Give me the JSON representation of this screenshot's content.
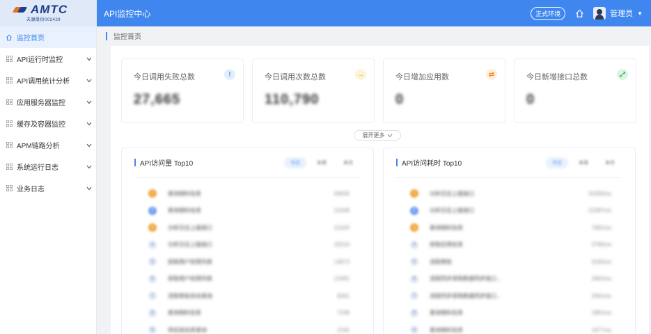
{
  "header": {
    "logo_text": "AMTC",
    "logo_subtitle": "天源股份002429",
    "app_title": "API监控中心",
    "env_badge": "正式环境",
    "user_name": "管理员",
    "colors": {
      "primary": "#3f86ef",
      "logo_bg": "#dfe9f8"
    }
  },
  "sidebar": {
    "items": [
      {
        "label": "监控首页",
        "icon": "home-icon",
        "active": true,
        "expandable": false
      },
      {
        "label": "API运行时监控",
        "icon": "grid-icon",
        "active": false,
        "expandable": true
      },
      {
        "label": "API调用统计分析",
        "icon": "grid-icon",
        "active": false,
        "expandable": true
      },
      {
        "label": "应用服务器监控",
        "icon": "grid-icon",
        "active": false,
        "expandable": true
      },
      {
        "label": "缓存及容器监控",
        "icon": "grid-icon",
        "active": false,
        "expandable": true
      },
      {
        "label": "APM链路分析",
        "icon": "grid-icon",
        "active": false,
        "expandable": true
      },
      {
        "label": "系统运行日志",
        "icon": "grid-icon",
        "active": false,
        "expandable": true
      },
      {
        "label": "业务日志",
        "icon": "grid-icon",
        "active": false,
        "expandable": true
      }
    ]
  },
  "breadcrumb": "监控首页",
  "stats": [
    {
      "title": "今日调用失败总数",
      "value": "27,665",
      "icon_glyph": "!",
      "icon_name": "alert-icon",
      "icon_color": "#3f86ef",
      "icon_bg": "#e3eefd"
    },
    {
      "title": "今日调用次数总数",
      "value": "110,790",
      "icon_glyph": "→",
      "icon_name": "arrow-right-icon",
      "icon_color": "#f2a60d",
      "icon_bg": "#fdf3dc"
    },
    {
      "title": "今日增加应用数",
      "value": "0",
      "icon_glyph": "⇄",
      "icon_name": "exchange-icon",
      "icon_color": "#f08a1c",
      "icon_bg": "#fdeedd"
    },
    {
      "title": "今日新增接口总数",
      "value": "0",
      "icon_glyph": "⤢",
      "icon_name": "link-icon",
      "icon_color": "#2bb04b",
      "icon_bg": "#def5e4"
    }
  ],
  "expand_label": "展开更多",
  "rank_panels": [
    {
      "title": "API访问量 Top10",
      "tabs": [
        "今日",
        "本周",
        "本月"
      ],
      "rows": [
        {
          "rank": "1",
          "name": "查询物料信息",
          "value": "64635",
          "color": "#f0a43a"
        },
        {
          "rank": "2",
          "name": "查询物料信息",
          "value": "21049",
          "color": "#6f9bf0"
        },
        {
          "rank": "3",
          "name": "分析日志上报接口",
          "value": "21420",
          "color": "#f0a43a"
        },
        {
          "rank": "4",
          "name": "分析日志上报接口",
          "value": "20210",
          "color": "#dfe6f4"
        },
        {
          "rank": "5",
          "name": "获取用户权限列表",
          "value": "13673",
          "color": "#dfe6f4"
        },
        {
          "rank": "6",
          "name": "获取用户权限列表",
          "value": "12491",
          "color": "#dfe6f4"
        },
        {
          "rank": "7",
          "name": "流程审批状态查询",
          "value": "8261",
          "color": "#dfe6f4"
        },
        {
          "rank": "8",
          "name": "查询物料信息",
          "value": "7249",
          "color": "#dfe6f4"
        },
        {
          "rank": "9",
          "name": "供应商信息查询",
          "value": "2245",
          "color": "#dfe6f4"
        }
      ]
    },
    {
      "title": "API访问耗时 Top10",
      "tabs": [
        "今日",
        "本周",
        "本月"
      ],
      "rows": [
        {
          "rank": "1",
          "name": "分析日志上报接口",
          "value": "31583ms",
          "color": "#f0a43a"
        },
        {
          "rank": "2",
          "name": "分析日志上报接口",
          "value": "21087ms",
          "color": "#6f9bf0"
        },
        {
          "rank": "3",
          "name": "查询物料信息",
          "value": "7681ms",
          "color": "#f0a43a"
        },
        {
          "rank": "4",
          "name": "获取应用信息",
          "value": "3780ms",
          "color": "#dfe6f4"
        },
        {
          "rank": "5",
          "name": "流程审批",
          "value": "3182ms",
          "color": "#dfe6f4"
        },
        {
          "rank": "6",
          "name": "流程同步采购数据同步接口...",
          "value": "2662ms",
          "color": "#dfe6f4"
        },
        {
          "rank": "7",
          "name": "流程同步采购数据同步接口...",
          "value": "2061ms",
          "color": "#dfe6f4"
        },
        {
          "rank": "8",
          "name": "查询物料信息",
          "value": "1861ms",
          "color": "#dfe6f4"
        },
        {
          "rank": "9",
          "name": "查询物料信息",
          "value": "1677ms",
          "color": "#dfe6f4"
        }
      ]
    }
  ]
}
